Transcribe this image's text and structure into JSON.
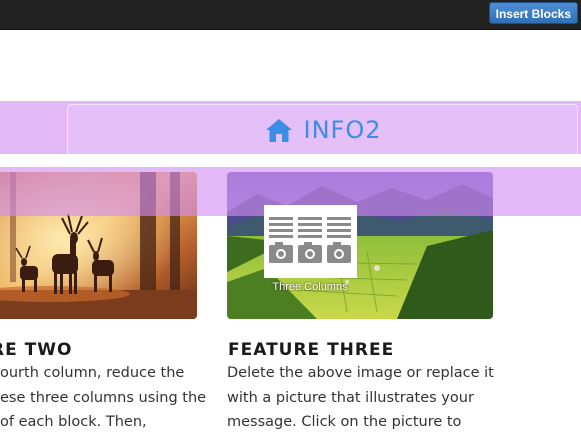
{
  "toolbar": {
    "insert_blocks_label": "Insert Blocks"
  },
  "info_bar": {
    "icon": "home-icon",
    "title": "INFO2",
    "color": "#3b8ee6"
  },
  "features": [
    {
      "title": "RE TWO",
      "lines": [
        "ourth column, reduce the",
        "ese three columns using the",
        "of each block. Then,"
      ]
    },
    {
      "title": "FEATURE THREE",
      "lines": [
        "Delete the above image or replace it",
        "with a picture that illustrates your",
        "message. Click on the picture to"
      ]
    }
  ],
  "layout_hint": {
    "icon": "three-columns-icon",
    "label": "Three Columns"
  },
  "colors": {
    "highlight": "#d28cf0",
    "topbar": "#222222",
    "button": "#3a7cc4"
  }
}
